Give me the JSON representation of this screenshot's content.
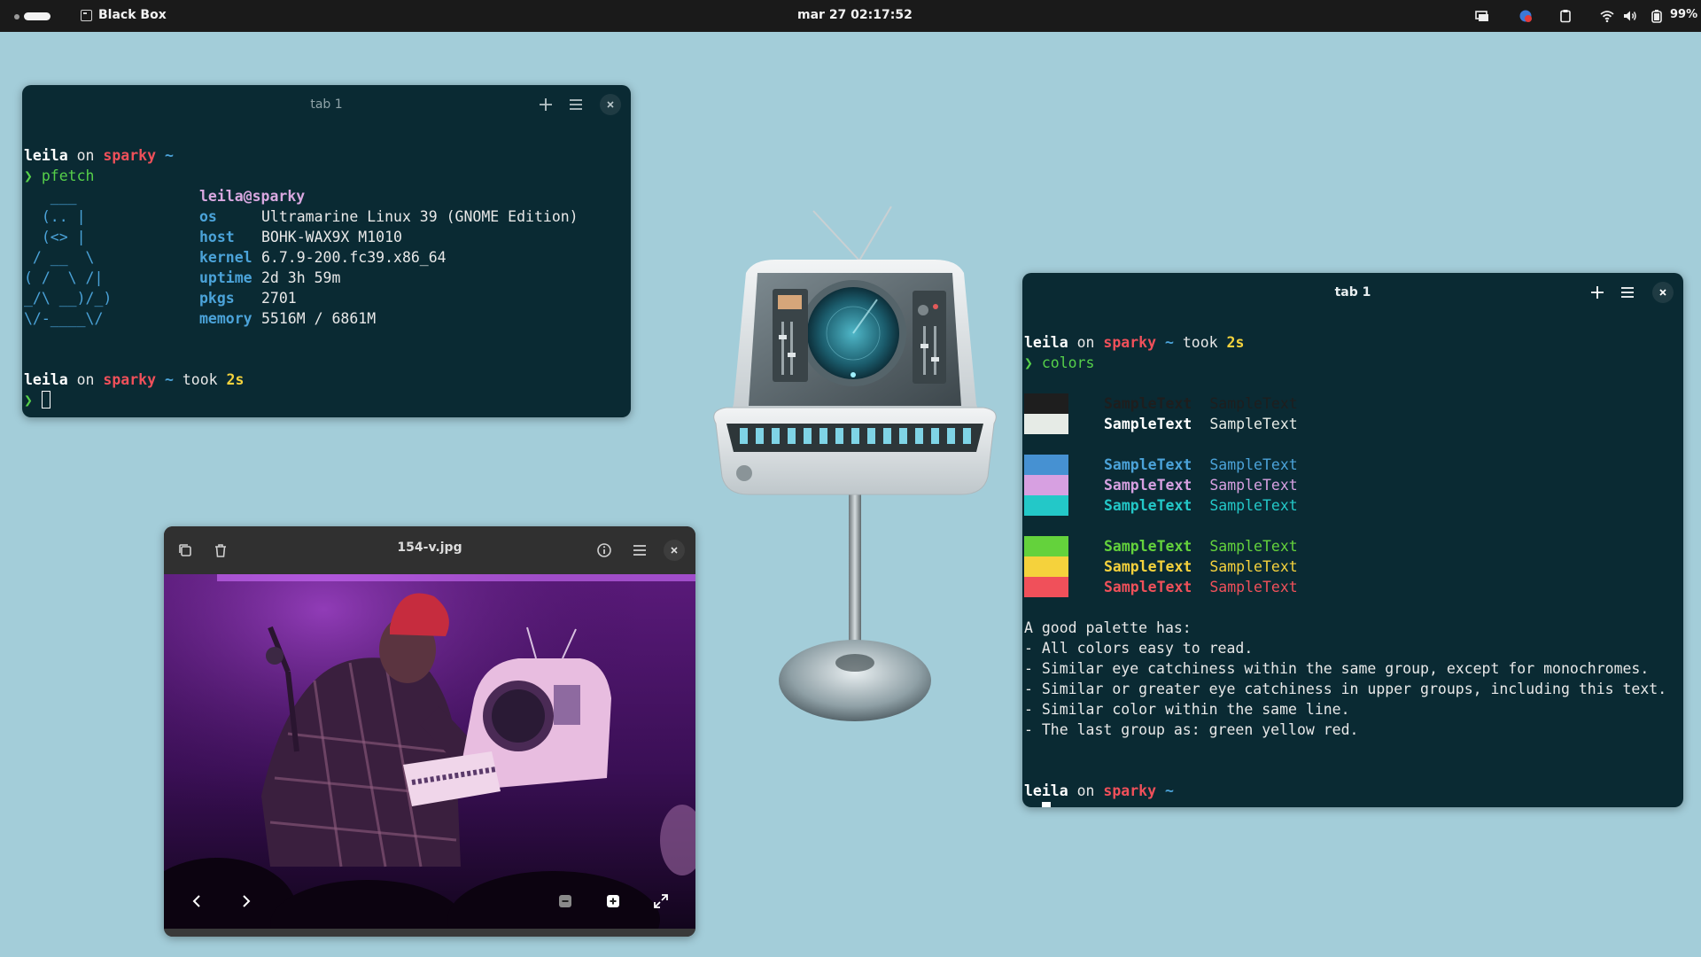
{
  "topbar": {
    "app_name": "Black Box",
    "clock": "mar 27  02:17:52",
    "battery": "99%"
  },
  "term1": {
    "tab_title": "tab 1",
    "user": "leila",
    "on": "on",
    "host": "sparky",
    "tilde": "~",
    "prompt_char": "❯",
    "command": "pfetch",
    "took_label": "took",
    "took_value": "2s",
    "pfetch": {
      "title": "leila@sparky",
      "logo": [
        "   ___",
        "  (.. |",
        "  (<> |",
        " / __  \\",
        "( /  \\ /|",
        "_/\\ __)/_)",
        "\\/-____\\/"
      ],
      "rows": [
        {
          "key": "os",
          "value": "Ultramarine Linux 39 (GNOME Edition)"
        },
        {
          "key": "host",
          "value": "BOHK-WAX9X M1010"
        },
        {
          "key": "kernel",
          "value": "6.7.9-200.fc39.x86_64"
        },
        {
          "key": "uptime",
          "value": "2d 3h 59m"
        },
        {
          "key": "pkgs",
          "value": "2701"
        },
        {
          "key": "memory",
          "value": "5516M / 6861M"
        }
      ]
    }
  },
  "term2": {
    "tab_title": "tab 1",
    "user": "leila",
    "on": "on",
    "host": "sparky",
    "tilde": "~",
    "took_label": "took",
    "took_value": "2s",
    "prompt_char": "❯",
    "command": "colors",
    "sample": "SampleText",
    "swatch_colors": [
      "#1e1e1e",
      "#e6ebe6",
      "#4691d2",
      "#d7a0e1",
      "#23c8c8",
      "#64d23c",
      "#f5d23c",
      "#f0505a"
    ],
    "palette_notes": [
      "A good palette has:",
      "- All colors easy to read.",
      "- Similar eye catchiness within the same group, except for monochromes.",
      "- Similar or greater eye catchiness in upper groups, including this text.",
      "- Similar color within the same line.",
      "- The last group as: green yellow red."
    ]
  },
  "viewer": {
    "title": "154-v.jpg"
  },
  "icons": {
    "copy": "copy-icon",
    "trash": "trash-icon",
    "info": "info-icon",
    "menu": "hamburger-menu-icon",
    "close": "close-icon",
    "prev": "chevron-left-icon",
    "next": "chevron-right-icon",
    "zoom_out": "zoom-out-icon",
    "zoom_in": "zoom-in-icon",
    "fullscreen": "fullscreen-icon"
  }
}
